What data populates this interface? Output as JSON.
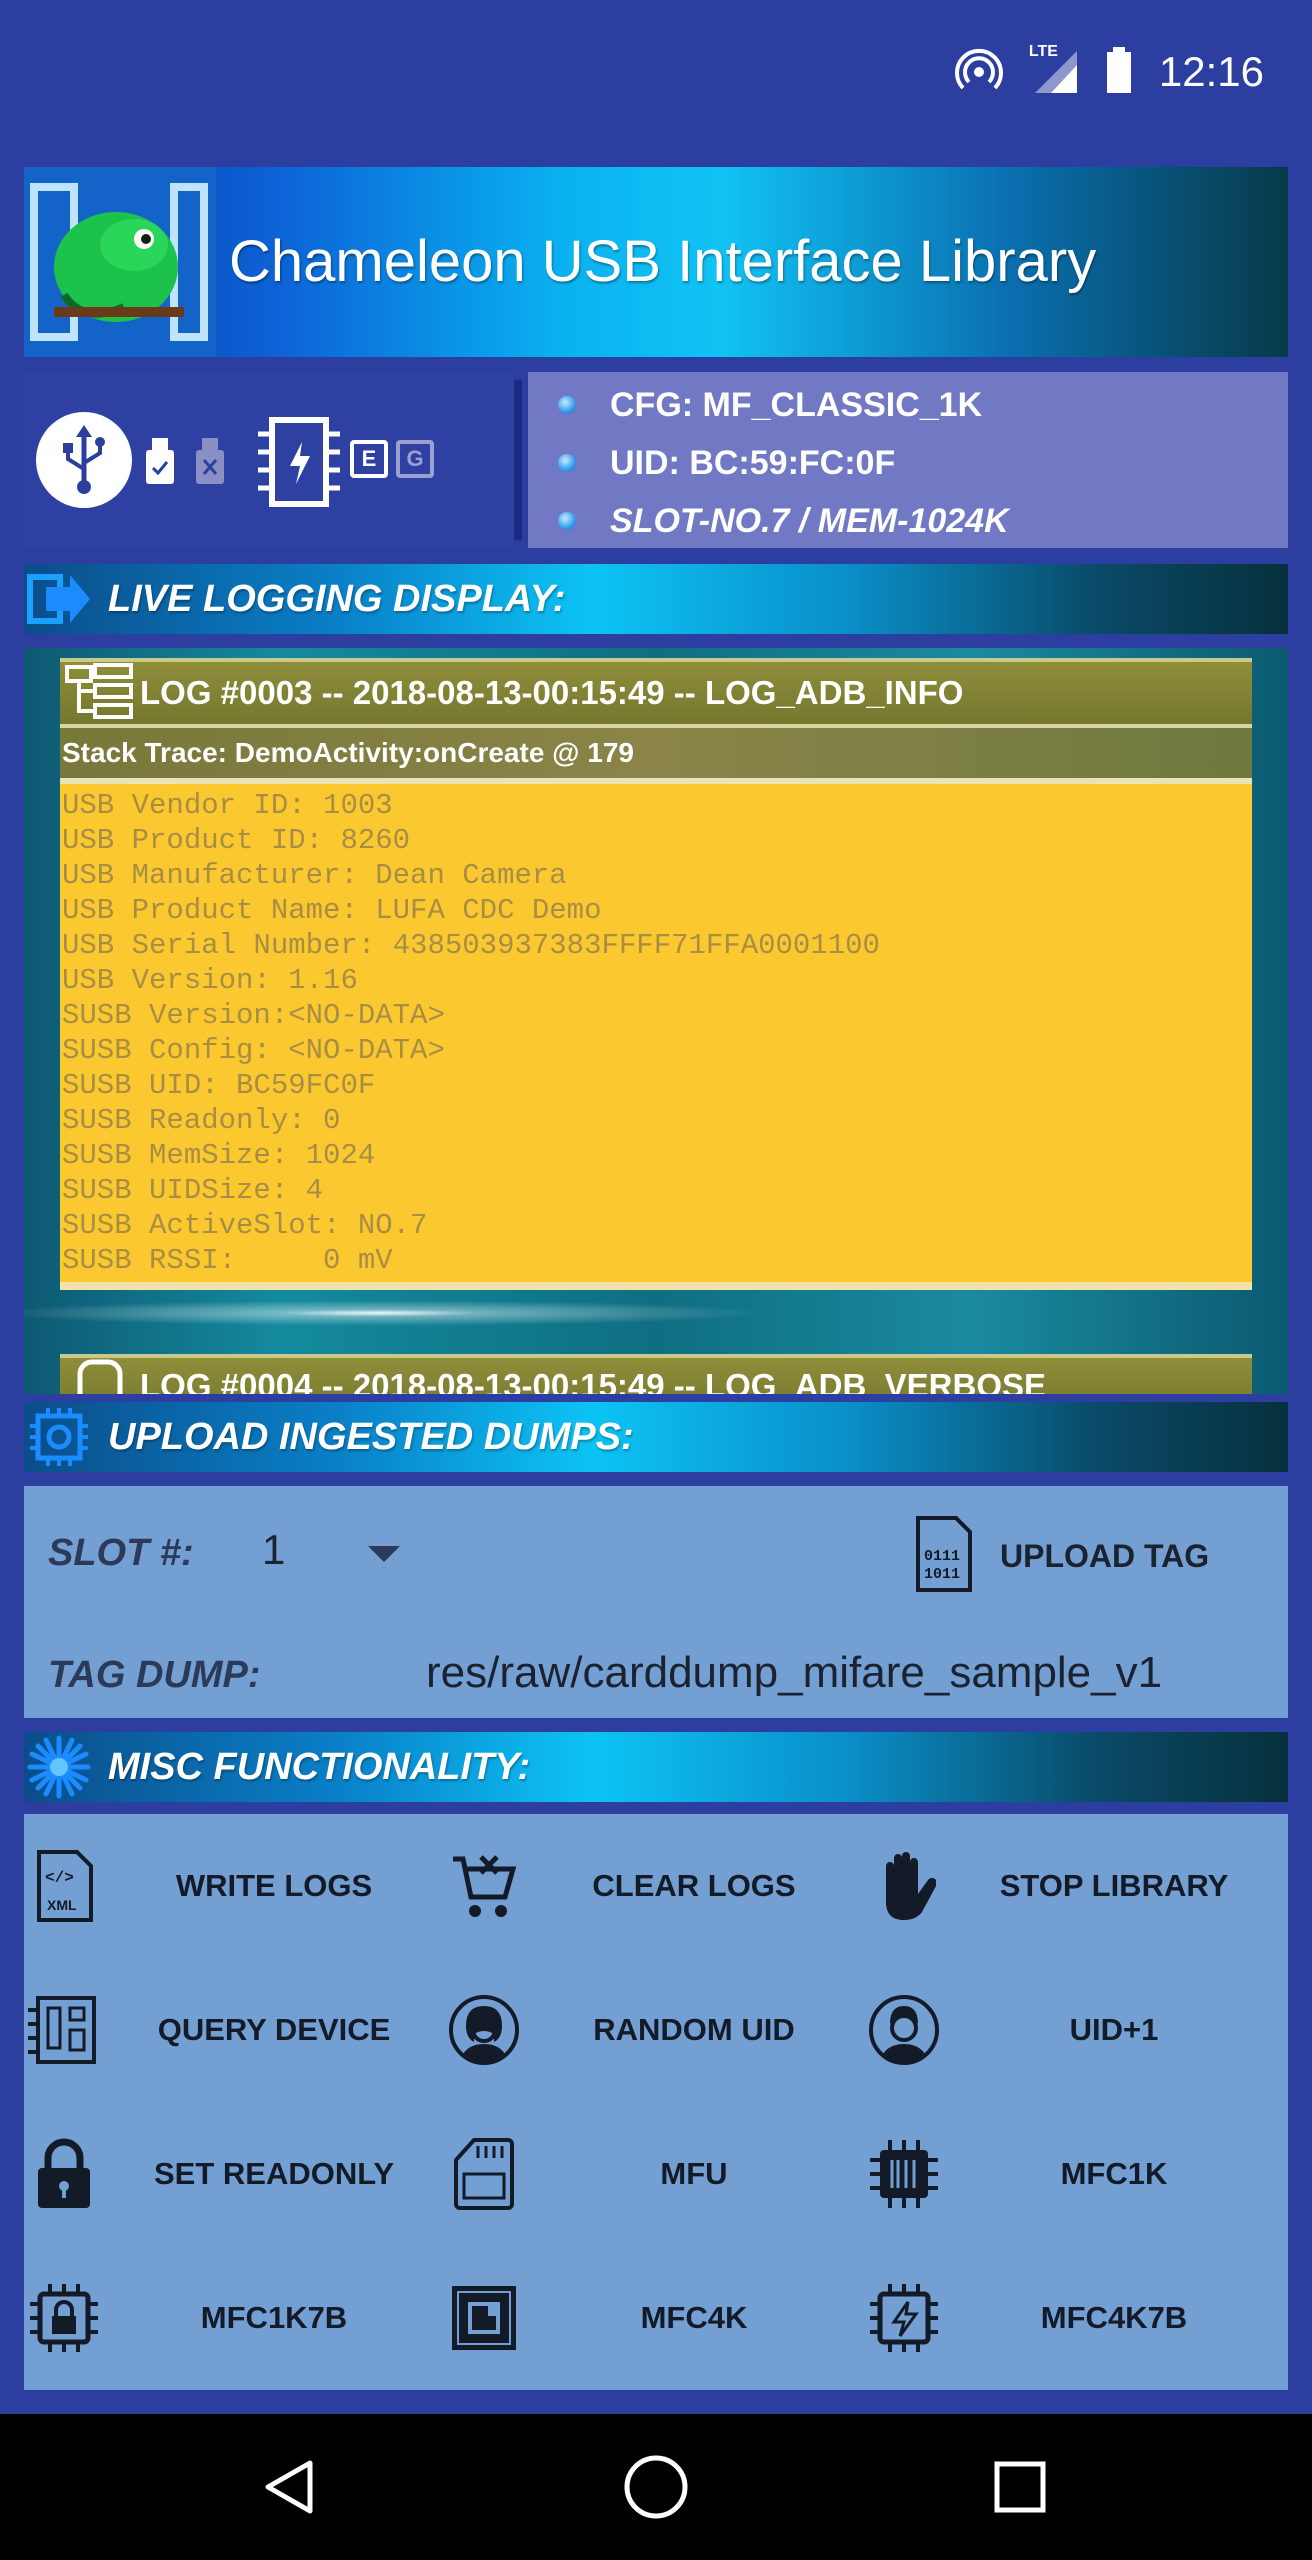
{
  "status_bar": {
    "time": "12:16",
    "network_label": "LTE",
    "icons": [
      "hotspot-icon",
      "signal-icon",
      "battery-icon"
    ]
  },
  "header": {
    "app_title": "Chameleon USB Interface Library",
    "logo_icon": "chameleon-logo"
  },
  "device_status": {
    "usb_indicators": [
      "usb-icon",
      "usb-drive-check-icon",
      "usb-drive-x-icon"
    ],
    "chip_indicators": [
      "chip-icon",
      "E",
      "G"
    ],
    "lines": [
      "CFG: MF_CLASSIC_1K",
      "UID: BC:59:FC:0F",
      "SLOT-NO.7 / MEM-1024K"
    ]
  },
  "sections": {
    "live_logging": "LIVE LOGGING DISPLAY:",
    "upload": "UPLOAD INGESTED DUMPS:",
    "misc": "MISC FUNCTIONALITY:"
  },
  "logs": [
    {
      "header": "LOG #0003 -- 2018-08-13-00:15:49 -- LOG_ADB_INFO",
      "stack_trace": "Stack Trace: DemoActivity:onCreate @ 179",
      "lines": [
        "USB Vendor ID: 1003",
        "USB Product ID: 8260",
        "USB Manufacturer: Dean Camera",
        "USB Product Name: LUFA CDC Demo",
        "USB Serial Number: 438503937383FFFF71FFA0001100",
        "USB Version: 1.16",
        "SUSB Version:<NO-DATA>",
        "SUSB Config: <NO-DATA>",
        "SUSB UID: BC59FC0F",
        "SUSB Readonly: 0",
        "SUSB MemSize: 1024",
        "SUSB UIDSize: 4",
        "SUSB ActiveSlot: NO.7",
        "SUSB RSSI:     0 mV"
      ]
    },
    {
      "header": "LOG #0004 -- 2018-08-13-00:15:49 -- LOG_ADB_VERBOSE"
    }
  ],
  "upload": {
    "slot_label": "SLOT #:",
    "slot_value": "1",
    "upload_button": "UPLOAD TAG",
    "tag_dump_label": "TAG DUMP:",
    "tag_dump_value": "res/raw/carddump_mifare_sample_v1"
  },
  "misc": {
    "buttons": [
      {
        "label": "WRITE LOGS",
        "icon": "xml-file-icon"
      },
      {
        "label": "CLEAR LOGS",
        "icon": "cart-clear-icon"
      },
      {
        "label": "STOP LIBRARY",
        "icon": "hand-stop-icon"
      },
      {
        "label": "QUERY DEVICE",
        "icon": "circuit-board-icon"
      },
      {
        "label": "RANDOM UID",
        "icon": "user-female-icon"
      },
      {
        "label": "UID+1",
        "icon": "user-male-icon"
      },
      {
        "label": "SET READONLY",
        "icon": "lock-icon"
      },
      {
        "label": "MFU",
        "icon": "sd-card-icon"
      },
      {
        "label": "MFC1K",
        "icon": "chip-barcode-icon"
      },
      {
        "label": "MFC1K7B",
        "icon": "chip-lock-icon"
      },
      {
        "label": "MFC4K",
        "icon": "chip-square-icon"
      },
      {
        "label": "MFC4K7B",
        "icon": "chip-bolt-icon"
      }
    ]
  },
  "nav_bar": {
    "buttons": [
      "back-icon",
      "home-icon",
      "recents-icon"
    ]
  },
  "colors": {
    "background": "#2c3ea0",
    "panel": "#749fd2",
    "log_body": "#fbc92f",
    "log_text": "#a88e45",
    "cfg_panel": "#7279c4"
  }
}
